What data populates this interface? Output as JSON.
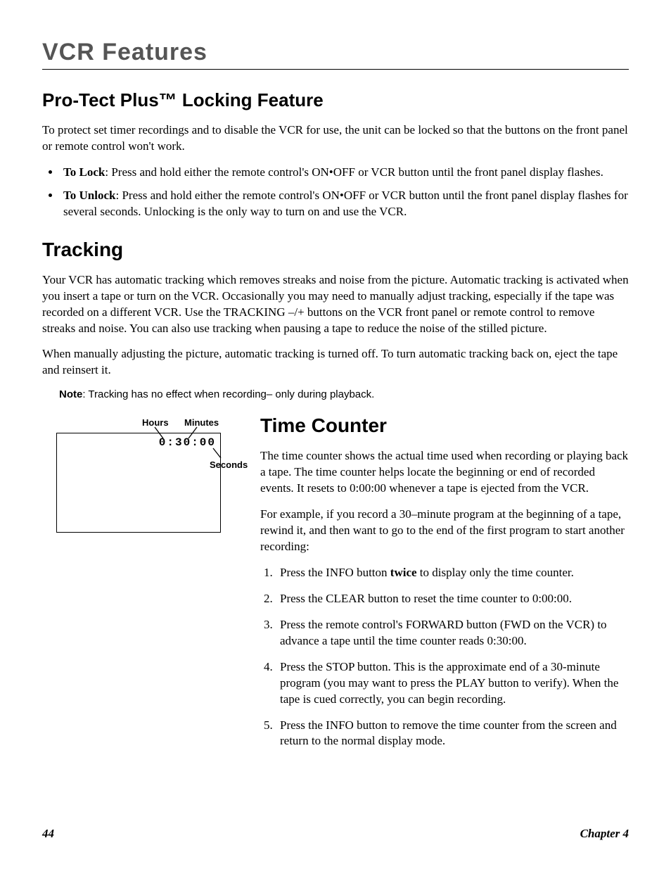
{
  "header": {
    "chapter_title": "VCR Features"
  },
  "section1": {
    "heading": "Pro-Tect Plus™ Locking Feature",
    "intro": "To protect set timer recordings and to disable the VCR for use, the unit can be locked so that the buttons on the front panel or remote control won't work.",
    "bullet1_label": "To Lock",
    "bullet1_text": ": Press and hold either the remote control's ON•OFF or VCR button  until the front panel display flashes.",
    "bullet2_label": "To Unlock",
    "bullet2_text": ": Press and hold either the remote control's ON•OFF or VCR button until the front panel display flashes for several seconds. Unlocking is the only way to turn on and use the VCR."
  },
  "section2": {
    "heading": "Tracking",
    "p1": "Your VCR has automatic tracking which removes streaks and noise from the picture. Automatic tracking is activated when you insert a tape or turn on the VCR. Occasionally you may need to manually adjust tracking, especially if the tape was recorded on a different VCR. Use the TRACKING –/+ buttons on the VCR front panel or remote control to remove streaks and noise. You can also use tracking when pausing a tape to reduce the noise of the stilled picture.",
    "p2": "When manually adjusting the picture, automatic tracking is turned off. To turn automatic tracking back on, eject the tape and reinsert it.",
    "note_label": "Note",
    "note_text": ": Tracking has no effect when recording– only during playback."
  },
  "diagram": {
    "hours": "Hours",
    "minutes": "Minutes",
    "seconds": "Seconds",
    "counter": "0:30:00"
  },
  "section3": {
    "heading": "Time Counter",
    "p1": "The time counter shows the actual time used when recording or playing back a tape. The time counter helps locate the beginning or end of recorded events. It resets to 0:00:00 whenever a tape is ejected from the VCR.",
    "p2": "For example, if you record a 30–minute program at the beginning of a tape, rewind it, and then want to go to the end of the first program to start another recording:",
    "step1_a": "Press the INFO button ",
    "step1_b": "twice",
    "step1_c": " to display only the time counter.",
    "step2": "Press the CLEAR button to reset the time counter to 0:00:00.",
    "step3": "Press the remote control's FORWARD button (FWD on the VCR) to advance a tape until the time counter reads 0:30:00.",
    "step4": "Press the STOP button. This is the approximate end of a 30-minute program (you may want to press the PLAY button to verify). When the tape is cued correctly, you can begin recording.",
    "step5": "Press the INFO button to remove the time counter from the screen and return to the normal display mode."
  },
  "footer": {
    "page": "44",
    "chapter": "Chapter 4"
  }
}
